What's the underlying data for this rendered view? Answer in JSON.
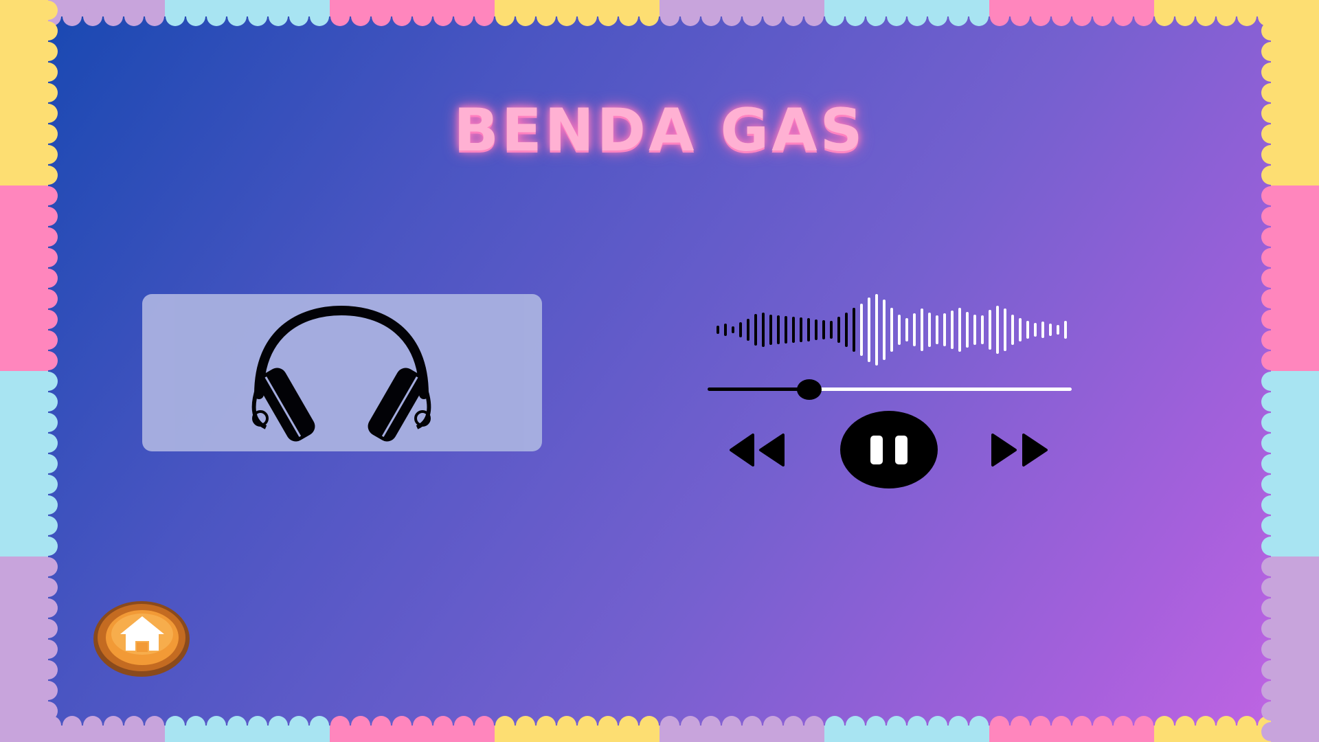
{
  "screen": {
    "title": "BENDA GAS"
  },
  "audio": {
    "icon": "headphones-icon",
    "progress": 0.28,
    "state": "playing"
  },
  "controls": {
    "rewind_icon": "rewind-icon",
    "pause_icon": "pause-icon",
    "forward_icon": "fast-forward-icon"
  },
  "navigation": {
    "home_icon": "home-icon"
  },
  "colors": {
    "title": "#ffb1d3",
    "card": "#a7afe0",
    "border_yellow": "#fdde72",
    "border_pink": "#ff86bd",
    "border_blue": "#a8e4f2",
    "border_lilac": "#c8a4dc",
    "home_button": "#f29a36"
  }
}
